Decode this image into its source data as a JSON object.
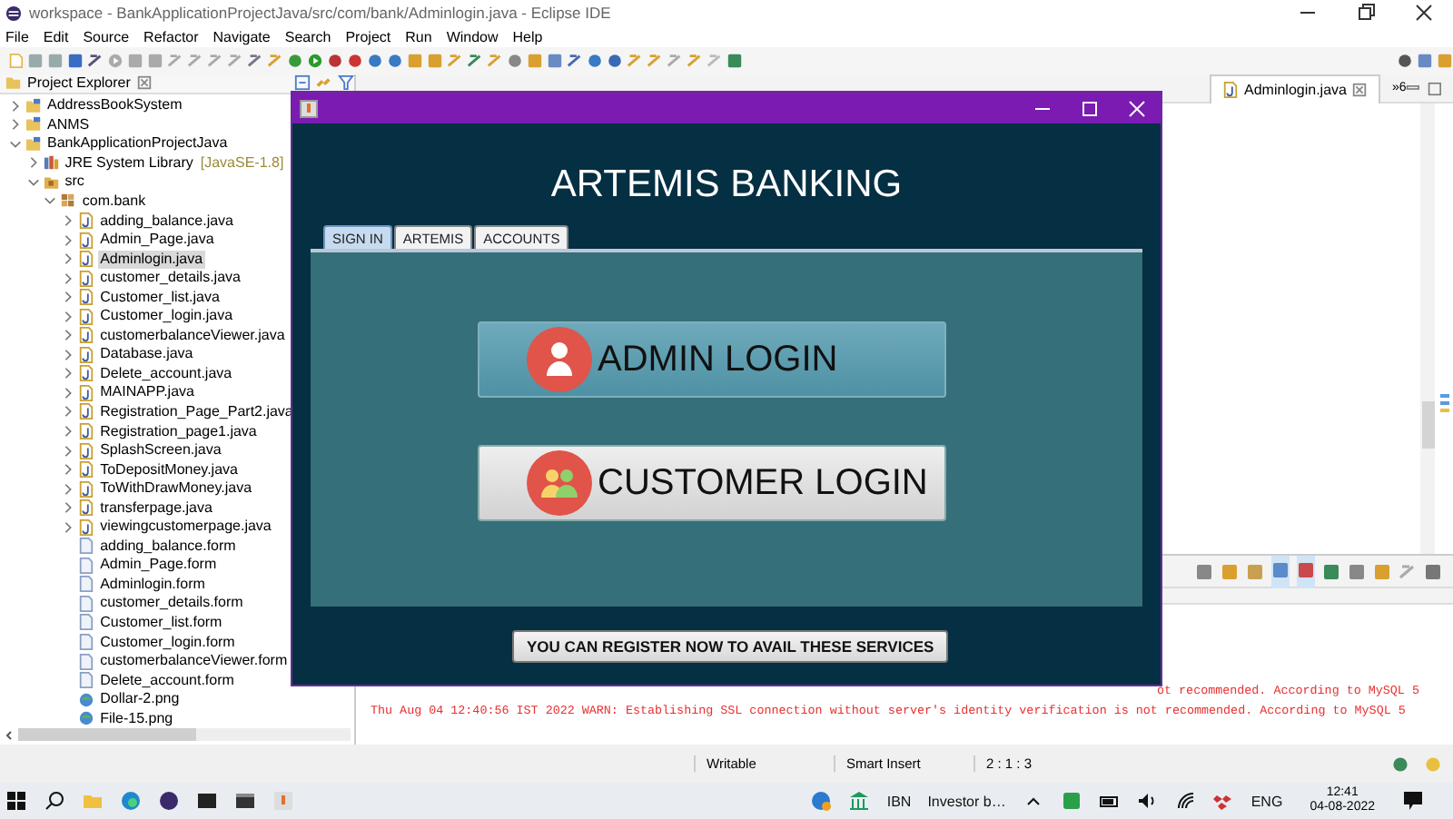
{
  "ide": {
    "title": "workspace - BankApplicationProjectJava/src/com/bank/Adminlogin.java - Eclipse IDE",
    "menu": [
      "File",
      "Edit",
      "Source",
      "Refactor",
      "Navigate",
      "Search",
      "Project",
      "Run",
      "Window",
      "Help"
    ],
    "explorer": {
      "title": "Project Explorer",
      "tree": [
        {
          "label": "AddressBookSystem",
          "kind": "project",
          "expanded": false,
          "selected": false
        },
        {
          "label": "ANMS",
          "kind": "project",
          "expanded": false,
          "selected": false
        },
        {
          "label": "BankApplicationProjectJava",
          "kind": "project",
          "expanded": true,
          "selected": false,
          "children": [
            {
              "label": "JRE System Library",
              "decoration": "[JavaSE-1.8]",
              "kind": "library",
              "expanded": false,
              "selected": false
            },
            {
              "label": "src",
              "kind": "source",
              "expanded": true,
              "selected": false,
              "children": [
                {
                  "label": "com.bank",
                  "kind": "package",
                  "expanded": true,
                  "selected": false,
                  "children": [
                    {
                      "label": "adding_balance.java",
                      "kind": "java",
                      "expanded": false,
                      "selected": false
                    },
                    {
                      "label": "Admin_Page.java",
                      "kind": "java",
                      "expanded": false,
                      "selected": false
                    },
                    {
                      "label": "Adminlogin.java",
                      "kind": "java",
                      "expanded": false,
                      "selected": true
                    },
                    {
                      "label": "customer_details.java",
                      "kind": "java",
                      "expanded": false,
                      "selected": false
                    },
                    {
                      "label": "Customer_list.java",
                      "kind": "java",
                      "expanded": false,
                      "selected": false
                    },
                    {
                      "label": "Customer_login.java",
                      "kind": "java",
                      "expanded": false,
                      "selected": false
                    },
                    {
                      "label": "customerbalanceViewer.java",
                      "kind": "java",
                      "expanded": false,
                      "selected": false
                    },
                    {
                      "label": "Database.java",
                      "kind": "java",
                      "expanded": false,
                      "selected": false
                    },
                    {
                      "label": "Delete_account.java",
                      "kind": "java",
                      "expanded": false,
                      "selected": false
                    },
                    {
                      "label": "MAINAPP.java",
                      "kind": "java",
                      "expanded": false,
                      "selected": false
                    },
                    {
                      "label": "Registration_Page_Part2.java",
                      "kind": "java",
                      "expanded": false,
                      "selected": false
                    },
                    {
                      "label": "Registration_page1.java",
                      "kind": "java",
                      "expanded": false,
                      "selected": false
                    },
                    {
                      "label": "SplashScreen.java",
                      "kind": "java",
                      "expanded": false,
                      "selected": false
                    },
                    {
                      "label": "ToDepositMoney.java",
                      "kind": "java",
                      "expanded": false,
                      "selected": false
                    },
                    {
                      "label": "ToWithDrawMoney.java",
                      "kind": "java",
                      "expanded": false,
                      "selected": false
                    },
                    {
                      "label": "transferpage.java",
                      "kind": "java",
                      "expanded": false,
                      "selected": false
                    },
                    {
                      "label": "viewingcustomerpage.java",
                      "kind": "java",
                      "expanded": false,
                      "selected": false
                    },
                    {
                      "label": "adding_balance.form",
                      "kind": "form",
                      "selected": false
                    },
                    {
                      "label": "Admin_Page.form",
                      "kind": "form",
                      "selected": false
                    },
                    {
                      "label": "Adminlogin.form",
                      "kind": "form",
                      "selected": false
                    },
                    {
                      "label": "customer_details.form",
                      "kind": "form",
                      "selected": false
                    },
                    {
                      "label": "Customer_list.form",
                      "kind": "form",
                      "selected": false
                    },
                    {
                      "label": "Customer_login.form",
                      "kind": "form",
                      "selected": false
                    },
                    {
                      "label": "customerbalanceViewer.form",
                      "kind": "form",
                      "selected": false
                    },
                    {
                      "label": "Delete_account.form",
                      "kind": "form",
                      "selected": false
                    },
                    {
                      "label": "Dollar-2.png",
                      "kind": "image",
                      "selected": false
                    },
                    {
                      "label": "File-15.png",
                      "kind": "image",
                      "selected": false
                    }
                  ]
                }
              ]
            }
          ]
        }
      ]
    },
    "editor_tabs": [
      {
        "label": "Adminlogin.java",
        "selected": true
      }
    ],
    "tab_overflow": "»6",
    "console_lines": [
      "ot recommended. According to MySQL 5",
      "Thu Aug 04 12:40:56 IST 2022 WARN: Establishing SSL connection without server's identity verification is not recommended. According to MySQL 5"
    ],
    "status": [
      "Writable",
      "Smart Insert",
      "2 : 1 : 3"
    ]
  },
  "app_window": {
    "heading": "ARTEMIS BANKING",
    "tabs": [
      {
        "label": "SIGN IN",
        "selected": true
      },
      {
        "label": "ARTEMIS",
        "selected": false
      },
      {
        "label": "ACCOUNTS",
        "selected": false
      }
    ],
    "buttons": [
      {
        "label": "ADMIN LOGIN",
        "kind": "admin",
        "focused": true
      },
      {
        "label": "CUSTOMER LOGIN",
        "kind": "customer",
        "focused": false
      }
    ],
    "register_button": "YOU CAN REGISTER NOW TO AVAIL THESE SERVICES"
  },
  "taskbar": {
    "tray_texts": [
      "IBN",
      "Investor b…"
    ],
    "language": "ENG",
    "time": "12:41",
    "date": "04-08-2022"
  }
}
